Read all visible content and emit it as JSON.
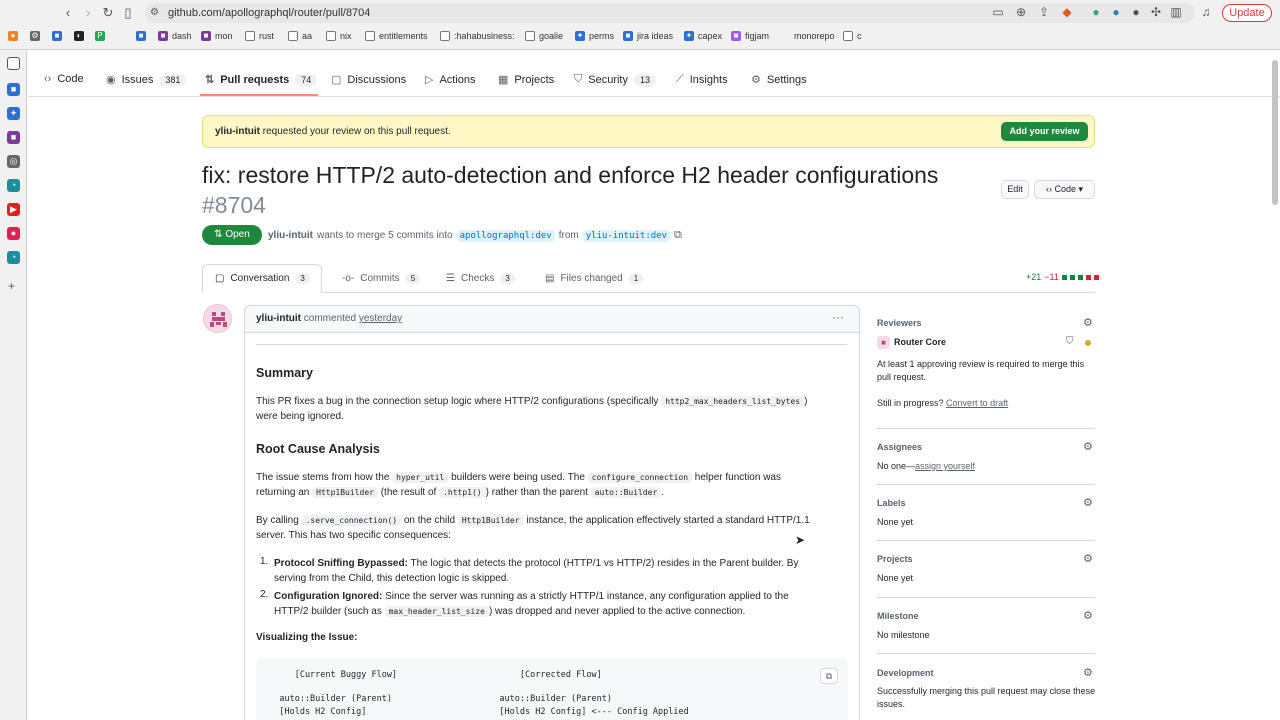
{
  "browser": {
    "url": "github.com/apollographql/router/pull/8704",
    "update_label": "Update",
    "bookmarks": [
      "dash",
      "mon",
      "rust",
      "aa",
      "nix",
      "entitlements",
      ":hahabusiness:",
      "goalie",
      "perms",
      "jira ideas",
      "capex",
      "figjam",
      "monorepo",
      "c"
    ]
  },
  "repo_nav": {
    "tabs": [
      {
        "label": "Code",
        "icon": "code-icon"
      },
      {
        "label": "Issues",
        "count": "381",
        "icon": "issue-icon"
      },
      {
        "label": "Pull requests",
        "count": "74",
        "icon": "pull-request-icon"
      },
      {
        "label": "Discussions",
        "icon": "discussion-icon"
      },
      {
        "label": "Actions",
        "icon": "play-icon"
      },
      {
        "label": "Projects",
        "icon": "table-icon"
      },
      {
        "label": "Security",
        "count": "13",
        "icon": "shield-icon"
      },
      {
        "label": "Insights",
        "icon": "graph-icon"
      },
      {
        "label": "Settings",
        "icon": "gear-icon"
      }
    ]
  },
  "banner": {
    "user": "yliu-intuit",
    "text": " requested your review on this pull request.",
    "button": "Add your review"
  },
  "pr": {
    "title": "fix: restore HTTP/2 auto-detection and enforce H2 header configurations",
    "number": "#8704",
    "status": "Open",
    "author": "yliu-intuit",
    "merge_text": "wants to merge 5 commits into",
    "base": "apollographql:dev",
    "from": "from",
    "head": "yliu-intuit:dev",
    "edit_label": "Edit",
    "code_label": "Code"
  },
  "pr_tabs": [
    {
      "label": "Conversation",
      "count": "3"
    },
    {
      "label": "Commits",
      "count": "5"
    },
    {
      "label": "Checks",
      "count": "3"
    },
    {
      "label": "Files changed",
      "count": "1"
    }
  ],
  "diffstat": {
    "add": "+21",
    "del": "−11"
  },
  "comment": {
    "author": "yliu-intuit",
    "verb": "commented",
    "when": "yesterday",
    "summary_h": "Summary",
    "summary_p1": "This PR fixes a bug in the connection setup logic where HTTP/2 configurations (specifically ",
    "summary_code": "http2_max_headers_list_bytes",
    "summary_p2": ")",
    "summary_p3": "were being ignored.",
    "root_h": "Root Cause Analysis",
    "root_a": "The issue stems from how the ",
    "root_code1": "hyper_util",
    "root_b": " builders were being used. The ",
    "root_code2": "configure_connection",
    "root_c": " helper function was",
    "root_d": "returning an ",
    "root_code3": "Http1Builder",
    "root_e": " (the result of ",
    "root_code4": ".http1()",
    "root_f": ") rather than the parent ",
    "root_code5": "auto::Builder",
    "root_g": ".",
    "call_a": "By calling ",
    "call_code1": ".serve_connection()",
    "call_b": " on the child ",
    "call_code2": "Http1Builder",
    "call_c": " instance, the application effectively started a standard HTTP/1.1",
    "call_d": "server. This has two specific consequences:",
    "li1_bold": "Protocol Sniffing Bypassed:",
    "li1_text": " The logic that detects the protocol (HTTP/1 vs HTTP/2) resides in the Parent builder. By",
    "li1_text2": "serving from the Child, this detection logic is skipped.",
    "li2_bold": "Configuration Ignored:",
    "li2_text": " Since the server was running as a strictly HTTP/1 instance, any configuration applied to the",
    "li2_text2a": "HTTP/2 builder (such as ",
    "li2_code": "max_header_list_size",
    "li2_text2b": ") was dropped and never applied to the active connection.",
    "viz_h": "Visualizing the Issue:",
    "code_lines": [
      "      [Current Buggy Flow]                        [Corrected Flow]",
      "",
      "   auto::Builder (Parent)                     auto::Builder (Parent)",
      "   [Holds H2 Config]                          [Holds H2 Config] <--- Config Applied"
    ]
  },
  "sidebar": {
    "reviewers_h": "Reviewers",
    "reviewer": "Router Core",
    "approve_text": "At least 1 approving review is required to merge this pull request.",
    "progress_a": "Still in progress?",
    "progress_link": "Convert to draft",
    "assignees_h": "Assignees",
    "assignees_a": "No one—",
    "assignees_link": "assign yourself",
    "labels_h": "Labels",
    "labels_v": "None yet",
    "projects_h": "Projects",
    "projects_v": "None yet",
    "milestone_h": "Milestone",
    "milestone_v": "No milestone",
    "development_h": "Development",
    "development_v": "Successfully merging this pull request may close these issues."
  }
}
